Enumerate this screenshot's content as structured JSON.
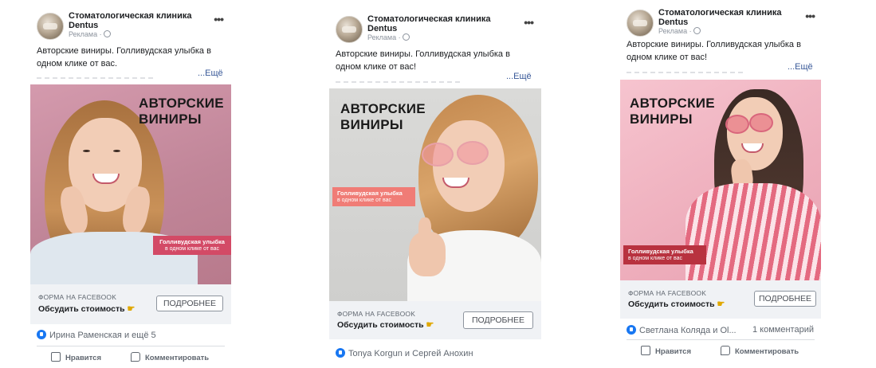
{
  "cards": [
    {
      "page_name_line1": "Стоматологическая клиника",
      "page_name_line2": "Dentus",
      "sponsored": "Реклама ·",
      "body_text": "Авторские виниры. Голливудская улыбка в одном клике от вас.",
      "see_more": "...Ещё",
      "headline_line1": "АВТОРСКИЕ",
      "headline_line2": "ВИНИРЫ",
      "tag_line1": "Голливудская улыбка",
      "tag_line2": "в одном клике от вас",
      "cta_small": "ФОРМА НА FACEBOOK",
      "cta_main": "Обсудить стоимость",
      "cta_button": "ПОДРОБНЕЕ",
      "reactions": "Ирина Раменская и ещё 5",
      "like_label": "Нравится",
      "comment_label": "Комментировать"
    },
    {
      "page_name_line1": "Стоматологическая клиника",
      "page_name_line2": "Dentus",
      "sponsored": "Реклама ·",
      "body_text": "Авторские виниры. Голливудская улыбка в одном клике от вас!",
      "see_more": "...Ещё",
      "headline_line1": "АВТОРСКИЕ",
      "headline_line2": "ВИНИРЫ",
      "tag_line1": "Голливудская улыбка",
      "tag_line2": "в одном клике от вас",
      "cta_small": "ФОРМА НА FACEBOOK",
      "cta_main": "Обсудить стоимость",
      "cta_button": "ПОДРОБНЕЕ",
      "reactions": "Tonya Korgun и Сергей Анохин"
    },
    {
      "page_name_line1": "Стоматологическая клиника",
      "page_name_line2": "Dentus",
      "sponsored": "Реклама ·",
      "body_text": "Авторские виниры. Голливудская улыбка в одном клике от вас!",
      "see_more": "...Ещё",
      "headline_line1": "АВТОРСКИЕ",
      "headline_line2": "ВИНИРЫ",
      "tag_line1": "Голливудская улыбка",
      "tag_line2": "в одном клике от вас",
      "cta_small": "ФОРМА НА FACEBOOK",
      "cta_main": "Обсудить стоимость",
      "cta_button": "ПОДРОБНЕЕ",
      "reactions": "Светлана Коляда и Ol...",
      "comments_count": "1 комментарий",
      "like_label": "Нравится",
      "comment_label": "Комментировать"
    }
  ],
  "colors": {
    "card1_bg": "#c98fa3",
    "card2_bg": "#d4d4d2",
    "card3_bg": "#f3b9c6",
    "tag1": "#d34a66",
    "tag2": "#f07c76",
    "tag3": "#b8323f",
    "link": "#385898",
    "like_blue": "#1877f2"
  }
}
